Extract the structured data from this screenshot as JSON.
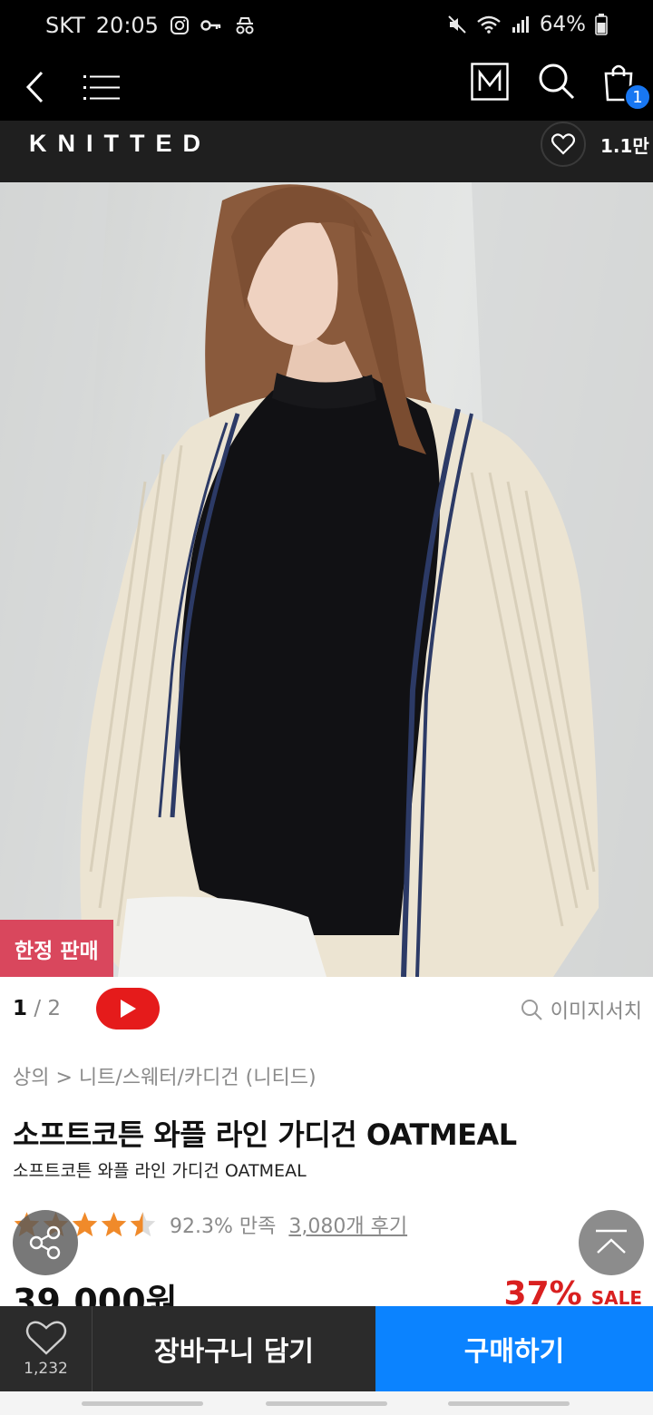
{
  "status_bar": {
    "carrier": "SKT",
    "time": "20:05",
    "battery": "64%"
  },
  "top_nav": {
    "cart_badge": "1",
    "m_logo": "M"
  },
  "brand": {
    "name": "KNITTED",
    "likes": "1.1만"
  },
  "product_image": {
    "badge": "한정 판매"
  },
  "image_meta": {
    "page_current": "1",
    "page_total": "/ 2",
    "image_search_label": "이미지서치"
  },
  "product": {
    "breadcrumb": "상의 > 니트/스웨터/카디건 (니티드)",
    "title": "소프트코튼 와플 라인 가디건 OATMEAL",
    "subtitle": "소프트코튼 와플 라인 가디건 OATMEAL",
    "rating_value": 4.5,
    "satisfaction": "92.3% 만족",
    "reviews": "3,080개 후기",
    "price": "39,000원",
    "discount": "37%",
    "sale_label": "SALE"
  },
  "bottom_bar": {
    "wish_count": "1,232",
    "cart_label": "장바구니 담기",
    "buy_label": "구매하기"
  },
  "colors": {
    "accent_blue": "#0b83ff",
    "sale_red": "#d92020",
    "badge_pink": "#d9475d",
    "star_orange": "#f08a2a",
    "youtube_red": "#e51b1b"
  },
  "icons": {
    "back": "chevron-left-icon",
    "menu": "list-menu-icon",
    "search": "search-icon",
    "cart": "shopping-bag-icon",
    "like": "heart-icon",
    "share": "share-icon",
    "top": "scroll-top-icon",
    "youtube": "play-icon"
  }
}
